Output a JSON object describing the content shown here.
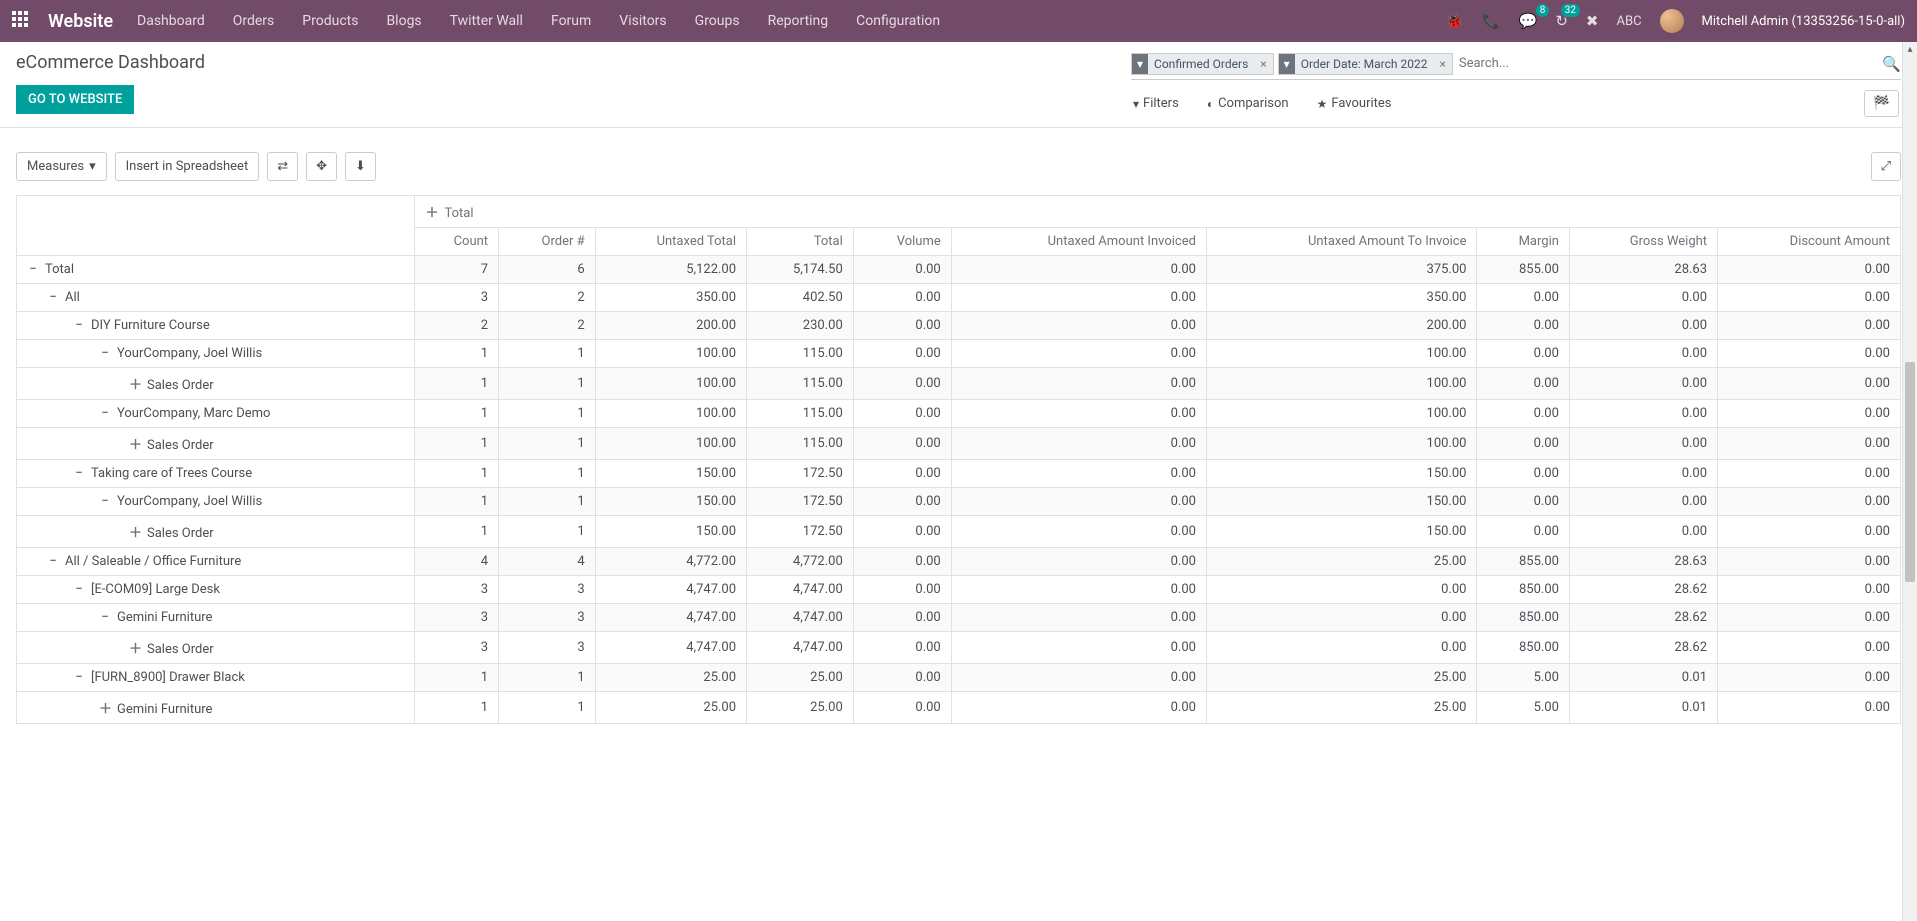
{
  "topnav": {
    "brand": "Website",
    "items": [
      "Dashboard",
      "Orders",
      "Products",
      "Blogs",
      "Twitter Wall",
      "Forum",
      "Visitors",
      "Groups",
      "Reporting",
      "Configuration"
    ],
    "msg_badge": "8",
    "clock_badge": "32",
    "company": "ABC",
    "user": "Mitchell Admin (13353256-15-0-all)"
  },
  "page": {
    "title": "eCommerce Dashboard",
    "go_btn": "GO TO WEBSITE"
  },
  "search": {
    "filters": [
      {
        "label": "Confirmed Orders"
      },
      {
        "label": "Order Date: March 2022"
      }
    ],
    "placeholder": "Search...",
    "opts": {
      "filters": "Filters",
      "comparison": "Comparison",
      "favourites": "Favourites"
    }
  },
  "toolbar": {
    "measures": "Measures",
    "insert": "Insert in Spreadsheet"
  },
  "pivot": {
    "total_label": "Total",
    "columns": [
      "Count",
      "Order #",
      "Untaxed Total",
      "Total",
      "Volume",
      "Untaxed Amount Invoiced",
      "Untaxed Amount To Invoice",
      "Margin",
      "Gross Weight",
      "Discount Amount"
    ],
    "rows": [
      {
        "indent": 0,
        "icon": "minus",
        "label": "Total",
        "vals": [
          "7",
          "6",
          "5,122.00",
          "5,174.50",
          "0.00",
          "0.00",
          "375.00",
          "855.00",
          "28.63",
          "0.00"
        ]
      },
      {
        "indent": 1,
        "icon": "minus",
        "label": "All",
        "vals": [
          "3",
          "2",
          "350.00",
          "402.50",
          "0.00",
          "0.00",
          "350.00",
          "0.00",
          "0.00",
          "0.00"
        ]
      },
      {
        "indent": 2,
        "icon": "minus",
        "label": "DIY Furniture Course",
        "vals": [
          "2",
          "2",
          "200.00",
          "230.00",
          "0.00",
          "0.00",
          "200.00",
          "0.00",
          "0.00",
          "0.00"
        ]
      },
      {
        "indent": 3,
        "icon": "minus",
        "label": "YourCompany, Joel Willis",
        "vals": [
          "1",
          "1",
          "100.00",
          "115.00",
          "0.00",
          "0.00",
          "100.00",
          "0.00",
          "0.00",
          "0.00"
        ]
      },
      {
        "indent": 4,
        "icon": "plus",
        "label": "Sales Order",
        "vals": [
          "1",
          "1",
          "100.00",
          "115.00",
          "0.00",
          "0.00",
          "100.00",
          "0.00",
          "0.00",
          "0.00"
        ]
      },
      {
        "indent": 3,
        "icon": "minus",
        "label": "YourCompany, Marc Demo",
        "vals": [
          "1",
          "1",
          "100.00",
          "115.00",
          "0.00",
          "0.00",
          "100.00",
          "0.00",
          "0.00",
          "0.00"
        ]
      },
      {
        "indent": 4,
        "icon": "plus",
        "label": "Sales Order",
        "vals": [
          "1",
          "1",
          "100.00",
          "115.00",
          "0.00",
          "0.00",
          "100.00",
          "0.00",
          "0.00",
          "0.00"
        ]
      },
      {
        "indent": 2,
        "icon": "minus",
        "label": "Taking care of Trees Course",
        "vals": [
          "1",
          "1",
          "150.00",
          "172.50",
          "0.00",
          "0.00",
          "150.00",
          "0.00",
          "0.00",
          "0.00"
        ]
      },
      {
        "indent": 3,
        "icon": "minus",
        "label": "YourCompany, Joel Willis",
        "vals": [
          "1",
          "1",
          "150.00",
          "172.50",
          "0.00",
          "0.00",
          "150.00",
          "0.00",
          "0.00",
          "0.00"
        ]
      },
      {
        "indent": 4,
        "icon": "plus",
        "label": "Sales Order",
        "vals": [
          "1",
          "1",
          "150.00",
          "172.50",
          "0.00",
          "0.00",
          "150.00",
          "0.00",
          "0.00",
          "0.00"
        ]
      },
      {
        "indent": 1,
        "icon": "minus",
        "label": "All / Saleable / Office Furniture",
        "vals": [
          "4",
          "4",
          "4,772.00",
          "4,772.00",
          "0.00",
          "0.00",
          "25.00",
          "855.00",
          "28.63",
          "0.00"
        ]
      },
      {
        "indent": 2,
        "icon": "minus",
        "label": "[E-COM09] Large Desk",
        "vals": [
          "3",
          "3",
          "4,747.00",
          "4,747.00",
          "0.00",
          "0.00",
          "0.00",
          "850.00",
          "28.62",
          "0.00"
        ]
      },
      {
        "indent": 3,
        "icon": "minus",
        "label": "Gemini Furniture",
        "vals": [
          "3",
          "3",
          "4,747.00",
          "4,747.00",
          "0.00",
          "0.00",
          "0.00",
          "850.00",
          "28.62",
          "0.00"
        ]
      },
      {
        "indent": 4,
        "icon": "plus",
        "label": "Sales Order",
        "vals": [
          "3",
          "3",
          "4,747.00",
          "4,747.00",
          "0.00",
          "0.00",
          "0.00",
          "850.00",
          "28.62",
          "0.00"
        ]
      },
      {
        "indent": 2,
        "icon": "minus",
        "label": "[FURN_8900] Drawer Black",
        "vals": [
          "1",
          "1",
          "25.00",
          "25.00",
          "0.00",
          "0.00",
          "25.00",
          "5.00",
          "0.01",
          "0.00"
        ]
      },
      {
        "indent": 3,
        "icon": "plus",
        "label": "Gemini Furniture",
        "vals": [
          "1",
          "1",
          "25.00",
          "25.00",
          "0.00",
          "0.00",
          "25.00",
          "5.00",
          "0.01",
          "0.00"
        ]
      }
    ]
  }
}
